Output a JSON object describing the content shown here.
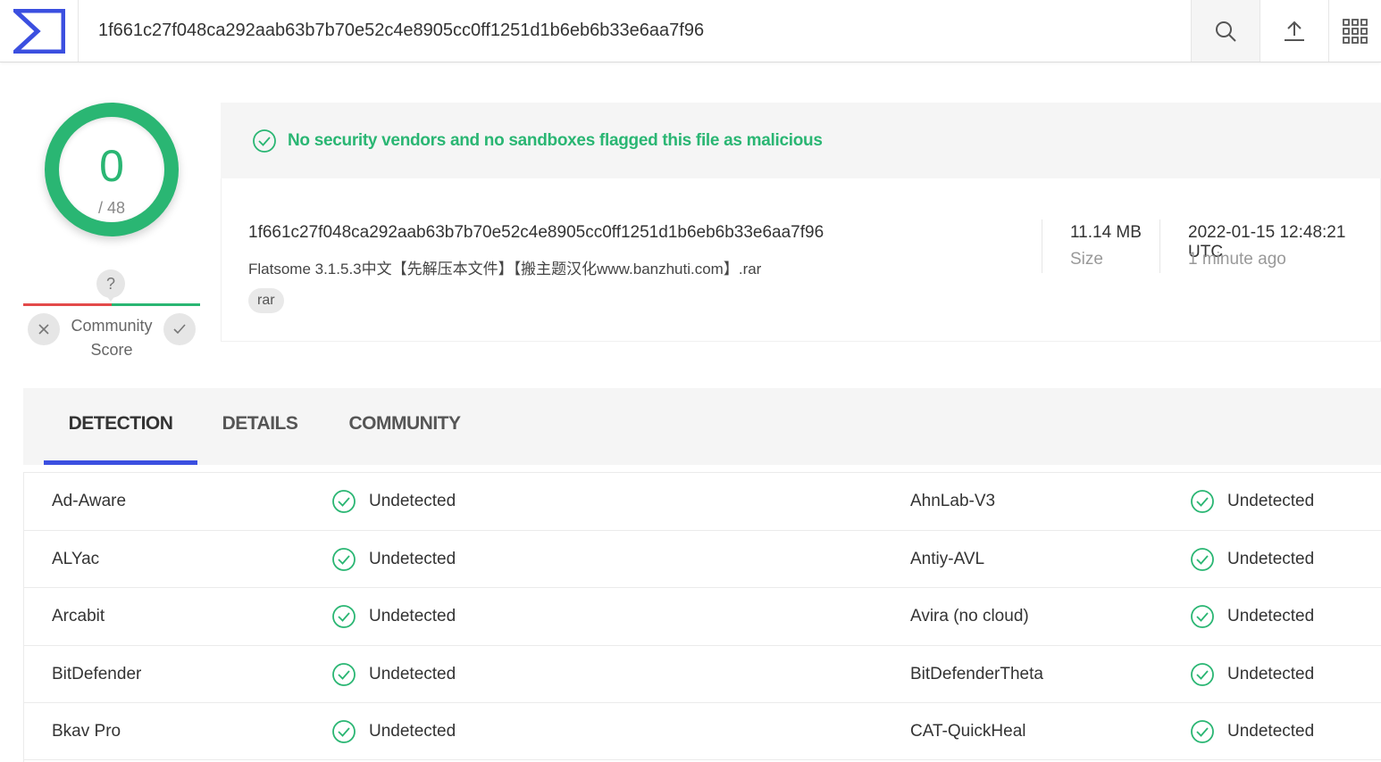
{
  "header": {
    "search_value": "1f661c27f048ca292aab63b7b70e52c4e8905cc0ff1251d1b6eb6b33e6aa7f96",
    "icons": [
      "virustotal-logo",
      "search-icon",
      "upload-icon",
      "apps-grid-icon"
    ]
  },
  "score": {
    "detections": "0",
    "total": "/ 48",
    "community_label_1": "Community",
    "community_label_2": "Score",
    "community_unknown": "?"
  },
  "banner": {
    "text": "No security vendors and no sandboxes flagged this file as malicious"
  },
  "file": {
    "hash": "1f661c27f048ca292aab63b7b70e52c4e8905cc0ff1251d1b6eb6b33e6aa7f96",
    "name": "Flatsome 3.1.5.3中文【先解压本文件】【搬主题汉化www.banzhuti.com】.rar",
    "tag": "rar",
    "size": "11.14 MB",
    "size_label": "Size",
    "date": "2022-01-15 12:48:21 UTC",
    "date_relative": "1 minute ago"
  },
  "tabs": [
    {
      "label": "DETECTION",
      "active": true
    },
    {
      "label": "DETAILS",
      "active": false
    },
    {
      "label": "COMMUNITY",
      "active": false
    }
  ],
  "detections": [
    {
      "left_engine": "Ad-Aware",
      "left_result": "Undetected",
      "right_engine": "AhnLab-V3",
      "right_result": "Undetected"
    },
    {
      "left_engine": "ALYac",
      "left_result": "Undetected",
      "right_engine": "Antiy-AVL",
      "right_result": "Undetected"
    },
    {
      "left_engine": "Arcabit",
      "left_result": "Undetected",
      "right_engine": "Avira (no cloud)",
      "right_result": "Undetected"
    },
    {
      "left_engine": "BitDefender",
      "left_result": "Undetected",
      "right_engine": "BitDefenderTheta",
      "right_result": "Undetected"
    },
    {
      "left_engine": "Bkav Pro",
      "left_result": "Undetected",
      "right_engine": "CAT-QuickHeal",
      "right_result": "Undetected"
    }
  ],
  "colors": {
    "accent_green": "#2ab673",
    "tab_underline": "#3b4fe0",
    "logo_blue": "#3b4fe0",
    "negative_red": "#e34a4a"
  }
}
